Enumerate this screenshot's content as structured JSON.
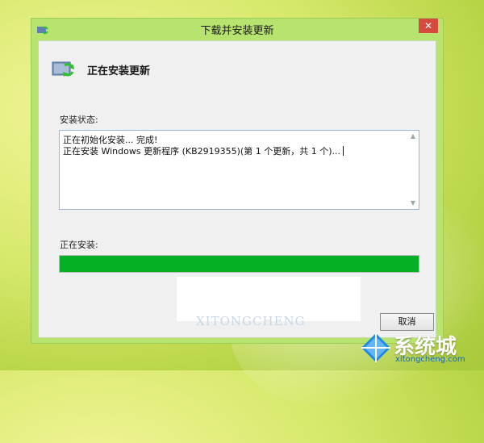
{
  "window": {
    "title": "下载并安装更新",
    "close_label": "✕"
  },
  "header": {
    "title": "正在安装更新"
  },
  "status": {
    "label": "安装状态:",
    "log_lines": [
      "正在初始化安装... 完成!",
      "正在安装 Windows 更新程序 (KB2919355)(第 1 个更新，共 1 个)..."
    ]
  },
  "progress": {
    "label": "正在安装:",
    "percent": 100,
    "fill_color": "#06b025"
  },
  "buttons": {
    "cancel_label": "取消"
  },
  "watermark": {
    "text": "XITONGCHENG"
  },
  "brand": {
    "name": "系统城",
    "domain": "xitongcheng.com"
  },
  "icons": {
    "title_icon": "update-icon",
    "header_icon": "update-icon",
    "brand_icon": "windows-logo-icon"
  },
  "colors": {
    "window_frame": "#b7e36f",
    "close_button": "#d74b3f",
    "progress": "#06b025"
  }
}
